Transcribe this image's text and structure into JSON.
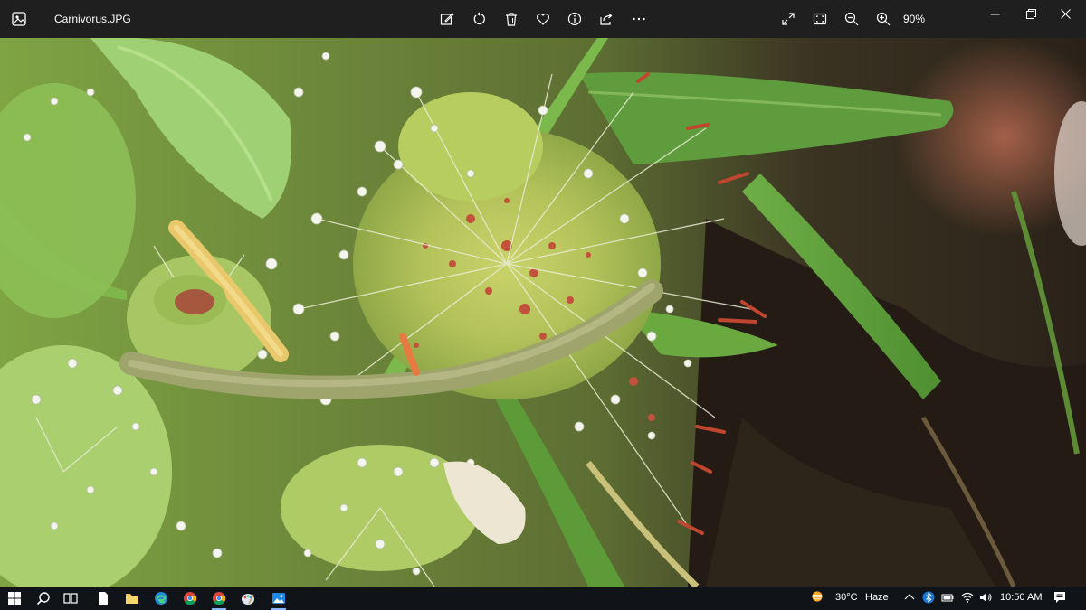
{
  "window": {
    "title": "Carnivorus.JPG",
    "zoom": "90%"
  },
  "toolbar": {
    "icons": [
      "edit-icon",
      "rotate-icon",
      "delete-icon",
      "favorite-icon",
      "info-icon",
      "share-icon",
      "more-icon"
    ],
    "view_icons": [
      "fullscreen-icon",
      "fit-window-icon",
      "zoom-out-icon",
      "zoom-in-icon"
    ]
  },
  "window_controls": [
    "minimize-icon",
    "restore-icon",
    "close-icon"
  ],
  "taskbar": {
    "apps": [
      "windows-start-icon",
      "search-icon",
      "task-view-icon",
      "file-icon",
      "file-explorer-icon",
      "edge-icon",
      "chrome-icon",
      "chrome-icon",
      "paint-icon",
      "photos-icon"
    ],
    "weather": {
      "temperature": "30°C",
      "condition": "Haze"
    },
    "time": "10:50 AM"
  },
  "colors": {
    "titlebar": "#1f1f1f",
    "taskbar": "#101418",
    "accent": "#7fb7ff"
  }
}
